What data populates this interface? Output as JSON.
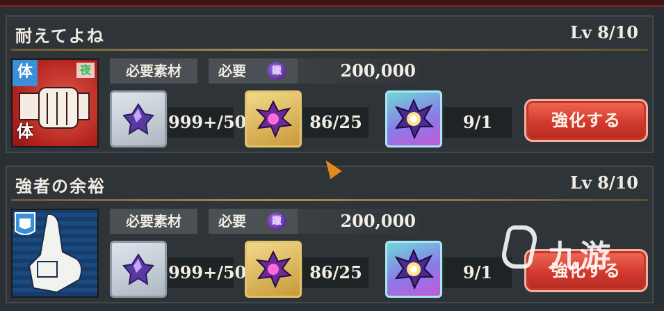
{
  "skills": [
    {
      "title": "耐えてよね",
      "level_label": "Lv 8/10",
      "icon": {
        "name": "fist-skill-icon",
        "badge_top_left": "体",
        "badge_top_right": "夜",
        "badge_bottom_left": "体"
      },
      "materials_label": "必要素材",
      "required_label": "必要",
      "currency_icon": "purple-coin-icon",
      "currency_glyph": "鑞",
      "cost": "200,000",
      "materials": [
        {
          "icon": "silver-crystal-icon",
          "count": "999+/50"
        },
        {
          "icon": "gold-crystal-icon",
          "count": "86/25"
        },
        {
          "icon": "rainbow-crystal-icon",
          "count": "9/1"
        }
      ],
      "button_label": "強化する"
    },
    {
      "title": "強者の余裕",
      "level_label": "Lv 8/10",
      "icon": {
        "name": "hand-gesture-skill-icon",
        "badge_top_left": "",
        "badge_top_right": "",
        "badge_bottom_left": ""
      },
      "materials_label": "必要素材",
      "required_label": "必要",
      "currency_icon": "purple-coin-icon",
      "currency_glyph": "鑞",
      "cost": "200,000",
      "materials": [
        {
          "icon": "silver-crystal-icon",
          "count": "999+/50"
        },
        {
          "icon": "gold-crystal-icon",
          "count": "86/25"
        },
        {
          "icon": "rainbow-crystal-icon",
          "count": "9/1"
        }
      ],
      "button_label": "強化する"
    }
  ],
  "watermark": {
    "text": "九游"
  },
  "colors": {
    "panel_bg": "#2e3438",
    "button_red": "#d23a2e",
    "divider_gold": "#a58e58"
  }
}
